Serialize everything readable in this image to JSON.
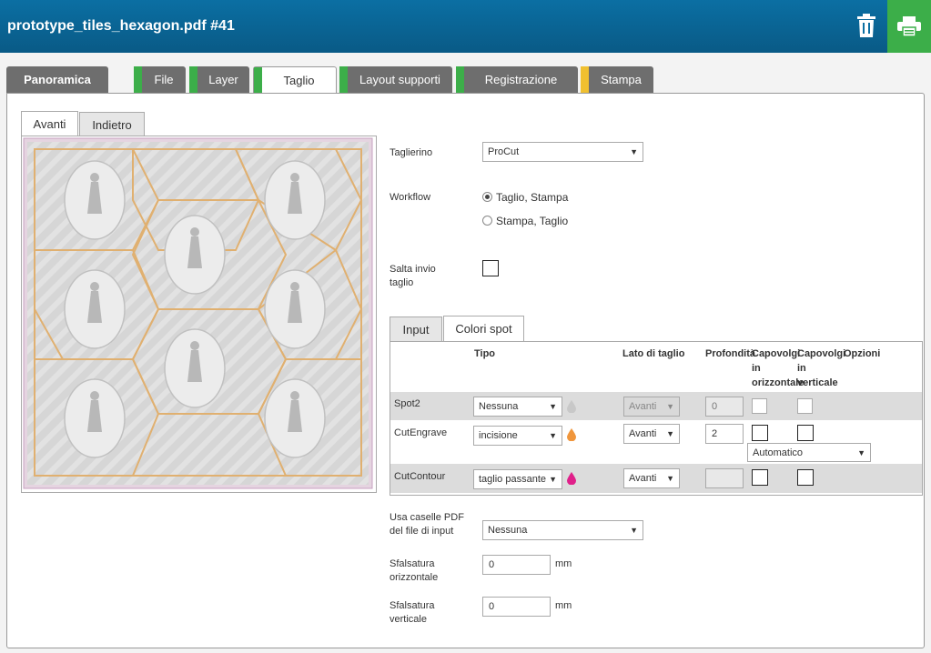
{
  "header": {
    "title": "prototype_tiles_hexagon.pdf #41",
    "trash_icon": "trash-icon",
    "print_icon": "printer-icon",
    "print_bg": "#3cae49",
    "bar_color": "#0b6fa3"
  },
  "tabs": [
    {
      "label": "Panoramica",
      "status": "none"
    },
    {
      "label": "File",
      "status": "green"
    },
    {
      "label": "Layer",
      "status": "green"
    },
    {
      "label": "Taglio",
      "status": "green",
      "active": true
    },
    {
      "label": "Layout supporti",
      "status": "green"
    },
    {
      "label": "Registrazione",
      "status": "green"
    },
    {
      "label": "Stampa",
      "status": "yellow"
    }
  ],
  "preview": {
    "tabs": [
      {
        "label": "Avanti",
        "active": true
      },
      {
        "label": "Indietro"
      }
    ]
  },
  "form": {
    "cutter_label": "Taglierino",
    "cutter_value": "ProCut",
    "workflow_label": "Workflow",
    "workflow_options": [
      "Taglio, Stampa",
      "Stampa, Taglio"
    ],
    "workflow_selected": "Taglio, Stampa",
    "skip_label": "Salta invio taglio",
    "skip_checked": false
  },
  "spot_tabs": [
    {
      "label": "Input"
    },
    {
      "label": "Colori spot",
      "active": true
    }
  ],
  "spot_table": {
    "headers": {
      "type": "Tipo",
      "side": "Lato di taglio",
      "depth": "Profondità",
      "flip_h": "Capovolgi in orizzontale",
      "flip_v": "Capovolgi in verticale",
      "options": "Opzioni"
    },
    "rows": [
      {
        "name": "Spot2",
        "type": "Nessuna",
        "side": "Avanti",
        "side_disabled": true,
        "depth": "0",
        "depth_disabled": true,
        "ink_color": "#c8c8c8"
      },
      {
        "name": "CutEngrave",
        "type": "incisione",
        "side": "Avanti",
        "depth": "2",
        "option": "Automatico",
        "ink_color": "#f0963c"
      },
      {
        "name": "CutContour",
        "type": "taglio passante",
        "side": "Avanti",
        "depth": "",
        "depth_disabled": true,
        "ink_color": "#e0208a"
      }
    ]
  },
  "bottom": {
    "pdf_boxes_label": "Usa caselle PDF del file di input",
    "pdf_boxes_value": "Nessuna",
    "h_offset_label": "Sfalsatura orizzontale",
    "h_offset_value": "0",
    "v_offset_label": "Sfalsatura verticale",
    "v_offset_value": "0",
    "unit": "mm"
  }
}
